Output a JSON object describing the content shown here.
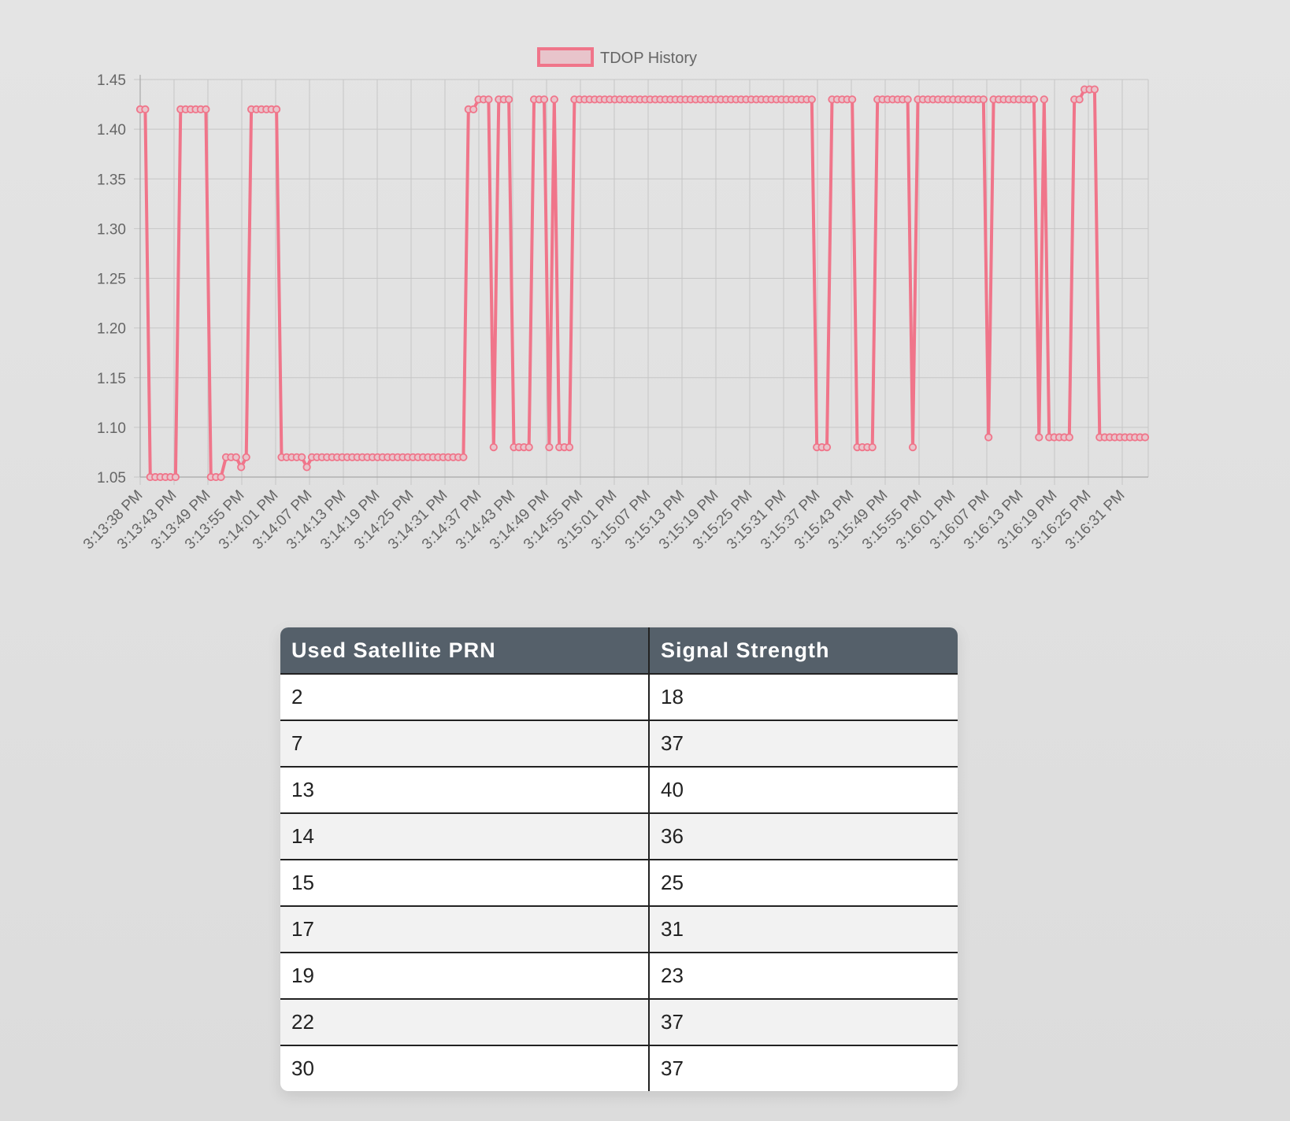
{
  "chart_data": {
    "type": "line",
    "legend": {
      "label": "TDOP History",
      "position": "top"
    },
    "ylim": [
      1.05,
      1.45
    ],
    "yticks": [
      "1.45",
      "1.40",
      "1.35",
      "1.30",
      "1.25",
      "1.20",
      "1.15",
      "1.10",
      "1.05"
    ],
    "xtick_labels": [
      "3:13:38 PM",
      "3:13:43 PM",
      "3:13:49 PM",
      "3:13:55 PM",
      "3:14:01 PM",
      "3:14:07 PM",
      "3:14:13 PM",
      "3:14:19 PM",
      "3:14:25 PM",
      "3:14:31 PM",
      "3:14:37 PM",
      "3:14:43 PM",
      "3:14:49 PM",
      "3:14:55 PM",
      "3:15:01 PM",
      "3:15:07 PM",
      "3:15:13 PM",
      "3:15:19 PM",
      "3:15:25 PM",
      "3:15:31 PM",
      "3:15:37 PM",
      "3:15:43 PM",
      "3:15:49 PM",
      "3:15:55 PM",
      "3:16:01 PM",
      "3:16:07 PM",
      "3:16:13 PM",
      "3:16:19 PM",
      "3:16:25 PM",
      "3:16:31 PM"
    ],
    "grid": true,
    "colors": {
      "line": "#f0758a",
      "legend_fill": "#e8c4cb",
      "grid": "#c6c6c6"
    },
    "series": [
      {
        "name": "TDOP History",
        "values": [
          1.42,
          1.42,
          1.05,
          1.05,
          1.05,
          1.05,
          1.05,
          1.05,
          1.42,
          1.42,
          1.42,
          1.42,
          1.42,
          1.42,
          1.05,
          1.05,
          1.05,
          1.07,
          1.07,
          1.07,
          1.06,
          1.07,
          1.42,
          1.42,
          1.42,
          1.42,
          1.42,
          1.42,
          1.07,
          1.07,
          1.07,
          1.07,
          1.07,
          1.06,
          1.07,
          1.07,
          1.07,
          1.07,
          1.07,
          1.07,
          1.07,
          1.07,
          1.07,
          1.07,
          1.07,
          1.07,
          1.07,
          1.07,
          1.07,
          1.07,
          1.07,
          1.07,
          1.07,
          1.07,
          1.07,
          1.07,
          1.07,
          1.07,
          1.07,
          1.07,
          1.07,
          1.07,
          1.07,
          1.07,
          1.07,
          1.42,
          1.42,
          1.43,
          1.43,
          1.43,
          1.08,
          1.43,
          1.43,
          1.43,
          1.08,
          1.08,
          1.08,
          1.08,
          1.43,
          1.43,
          1.43,
          1.08,
          1.43,
          1.08,
          1.08,
          1.08,
          1.43,
          1.43,
          1.43,
          1.43,
          1.43,
          1.43,
          1.43,
          1.43,
          1.43,
          1.43,
          1.43,
          1.43,
          1.43,
          1.43,
          1.43,
          1.43,
          1.43,
          1.43,
          1.43,
          1.43,
          1.43,
          1.43,
          1.43,
          1.43,
          1.43,
          1.43,
          1.43,
          1.43,
          1.43,
          1.43,
          1.43,
          1.43,
          1.43,
          1.43,
          1.43,
          1.43,
          1.43,
          1.43,
          1.43,
          1.43,
          1.43,
          1.43,
          1.43,
          1.43,
          1.43,
          1.43,
          1.43,
          1.43,
          1.08,
          1.08,
          1.08,
          1.43,
          1.43,
          1.43,
          1.43,
          1.43,
          1.08,
          1.08,
          1.08,
          1.08,
          1.43,
          1.43,
          1.43,
          1.43,
          1.43,
          1.43,
          1.43,
          1.08,
          1.43,
          1.43,
          1.43,
          1.43,
          1.43,
          1.43,
          1.43,
          1.43,
          1.43,
          1.43,
          1.43,
          1.43,
          1.43,
          1.43,
          1.09,
          1.43,
          1.43,
          1.43,
          1.43,
          1.43,
          1.43,
          1.43,
          1.43,
          1.43,
          1.09,
          1.43,
          1.09,
          1.09,
          1.09,
          1.09,
          1.09,
          1.43,
          1.43,
          1.44,
          1.44,
          1.44,
          1.09,
          1.09,
          1.09,
          1.09,
          1.09,
          1.09,
          1.09,
          1.09,
          1.09,
          1.09
        ]
      }
    ]
  },
  "table": {
    "headers": [
      "Used Satellite PRN",
      "Signal Strength"
    ],
    "rows": [
      [
        "2",
        "18"
      ],
      [
        "7",
        "37"
      ],
      [
        "13",
        "40"
      ],
      [
        "14",
        "36"
      ],
      [
        "15",
        "25"
      ],
      [
        "17",
        "31"
      ],
      [
        "19",
        "23"
      ],
      [
        "22",
        "37"
      ],
      [
        "30",
        "37"
      ]
    ]
  }
}
